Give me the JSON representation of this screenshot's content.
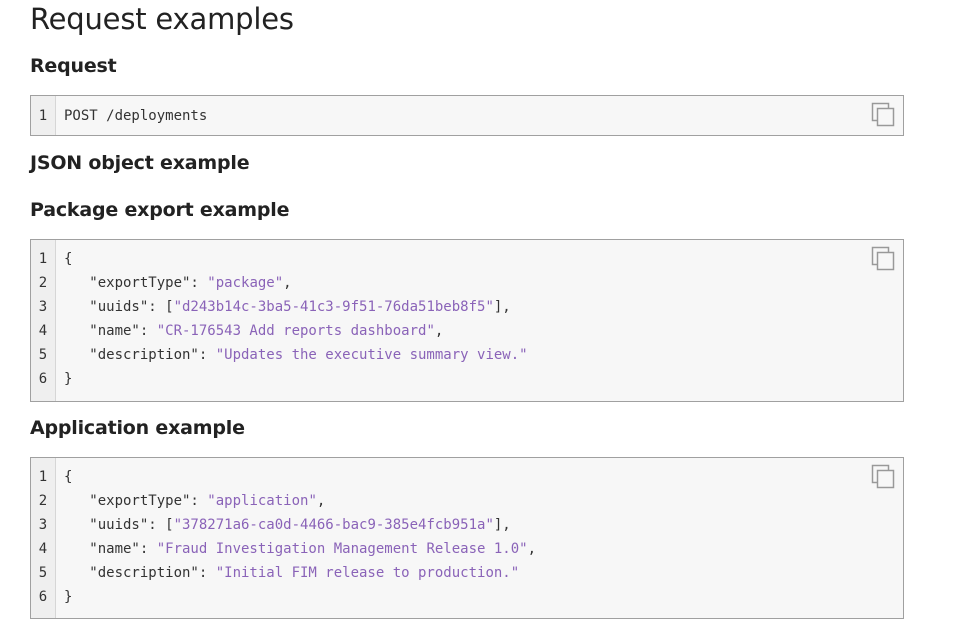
{
  "page_title": "Request examples",
  "request": {
    "heading": "Request",
    "lines": [
      [
        {
          "t": "POST /deployments"
        }
      ]
    ]
  },
  "json_heading": "JSON object example",
  "package": {
    "heading": "Package export example",
    "lines": [
      [
        {
          "t": "{"
        }
      ],
      [
        {
          "t": "   \"exportType\": "
        },
        {
          "t": "\"package\"",
          "s": true
        },
        {
          "t": ","
        }
      ],
      [
        {
          "t": "   \"uuids\": ["
        },
        {
          "t": "\"d243b14c-3ba5-41c3-9f51-76da51beb8f5\"",
          "s": true
        },
        {
          "t": "],"
        }
      ],
      [
        {
          "t": "   \"name\": "
        },
        {
          "t": "\"CR-176543 Add reports dashboard\"",
          "s": true
        },
        {
          "t": ","
        }
      ],
      [
        {
          "t": "   \"description\": "
        },
        {
          "t": "\"Updates the executive summary view.\"",
          "s": true
        }
      ],
      [
        {
          "t": "}"
        }
      ]
    ]
  },
  "application": {
    "heading": "Application example",
    "lines": [
      [
        {
          "t": "{"
        }
      ],
      [
        {
          "t": "   \"exportType\": "
        },
        {
          "t": "\"application\"",
          "s": true
        },
        {
          "t": ","
        }
      ],
      [
        {
          "t": "   \"uuids\": ["
        },
        {
          "t": "\"378271a6-ca0d-4466-bac9-385e4fcb951a\"",
          "s": true
        },
        {
          "t": "],"
        }
      ],
      [
        {
          "t": "   \"name\": "
        },
        {
          "t": "\"Fraud Investigation Management Release 1.0\"",
          "s": true
        },
        {
          "t": ","
        }
      ],
      [
        {
          "t": "   \"description\": "
        },
        {
          "t": "\"Initial FIM release to production.\"",
          "s": true
        }
      ],
      [
        {
          "t": "}"
        }
      ]
    ]
  },
  "icons": {
    "copy": "copy-icon"
  },
  "colors": {
    "string": "#8a63b8",
    "border": "#a0a0a0",
    "code_bg": "#f7f7f7"
  }
}
